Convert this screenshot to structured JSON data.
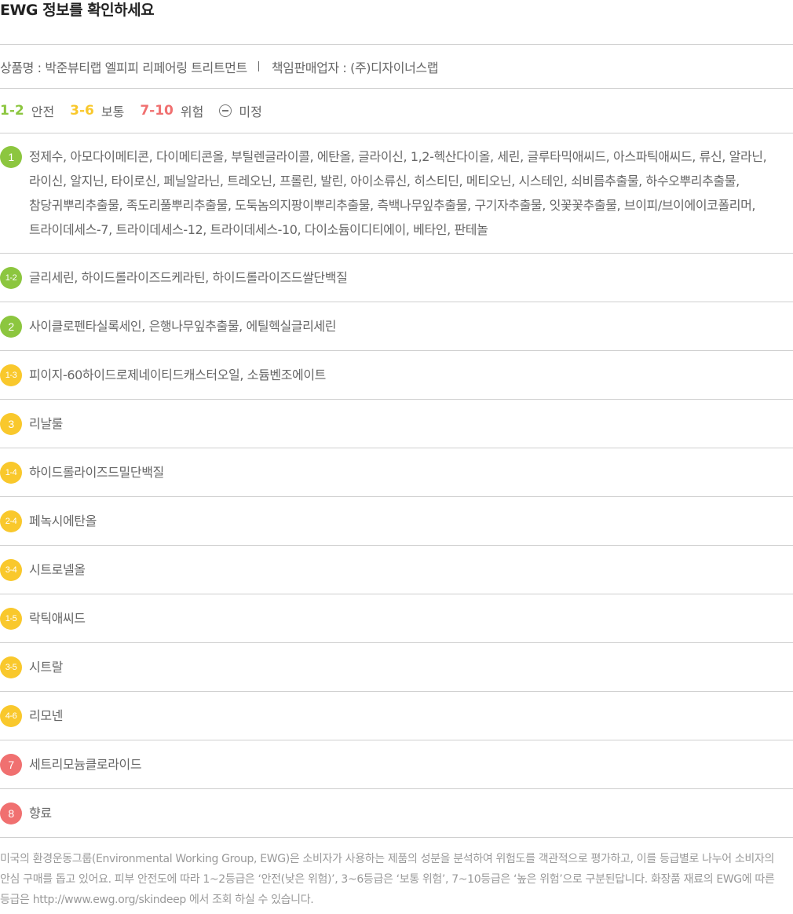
{
  "title": "EWG 정보를 확인하세요",
  "product": {
    "name_text": "상품명 : 박준뷰티랩 엘피피 리페어링 트리트먼트",
    "seller_text": "책임판매업자 : (주)디자이너스랩"
  },
  "legend": {
    "items": [
      {
        "range": "1-2",
        "label": "안전",
        "color": "#8cc63f"
      },
      {
        "range": "3-6",
        "label": "보통",
        "color": "#f9c82c"
      },
      {
        "range": "7-10",
        "label": "위험",
        "color": "#f07070"
      }
    ],
    "undefined_label": "미정",
    "undefined_icon": "minus-circle-icon"
  },
  "colors": {
    "green": "#8cc63f",
    "yellow": "#f9c82c",
    "red": "#f07070"
  },
  "rows": [
    {
      "grade": "1",
      "color": "#8cc63f",
      "ingredients": "정제수, 아모다이메티콘, 다이메티콘올, 부틸렌글라이콜, 에탄올, 글라이신, 1,2-헥산다이올, 세린, 글루타믹애씨드, 아스파틱애씨드, 류신, 알라닌, 라이신, 알지닌, 타이로신, 페닐알라닌, 트레오닌, 프롤린, 발린, 아이소류신, 히스티딘, 메티오닌, 시스테인, 쇠비름추출물, 하수오뿌리추출물, 참당귀뿌리추출물, 족도리풀뿌리추출물, 도둑놈의지팡이뿌리추출물, 측백나무잎추출물, 구기자추출물, 잇꽃꽃추출물, 브이피/브이에이코폴리머, 트라이데세스-7, 트라이데세스-12, 트라이데세스-10, 다이소듐이디티에이, 베타인, 판테놀"
    },
    {
      "grade": "1-2",
      "color": "#8cc63f",
      "ingredients": "글리세린, 하이드롤라이즈드케라틴, 하이드롤라이즈드쌀단백질"
    },
    {
      "grade": "2",
      "color": "#8cc63f",
      "ingredients": "사이클로펜타실록세인, 은행나무잎추출물, 에틸헥실글리세린"
    },
    {
      "grade": "1-3",
      "color": "#f9c82c",
      "ingredients": "피이지-60하이드로제네이티드캐스터오일, 소듐벤조에이트"
    },
    {
      "grade": "3",
      "color": "#f9c82c",
      "ingredients": "리날룰"
    },
    {
      "grade": "1-4",
      "color": "#f9c82c",
      "ingredients": "하이드롤라이즈드밀단백질"
    },
    {
      "grade": "2-4",
      "color": "#f9c82c",
      "ingredients": "페녹시에탄올"
    },
    {
      "grade": "3-4",
      "color": "#f9c82c",
      "ingredients": "시트로넬올"
    },
    {
      "grade": "1-5",
      "color": "#f9c82c",
      "ingredients": "락틱애씨드"
    },
    {
      "grade": "3-5",
      "color": "#f9c82c",
      "ingredients": "시트랄"
    },
    {
      "grade": "4-6",
      "color": "#f9c82c",
      "ingredients": "리모넨"
    },
    {
      "grade": "7",
      "color": "#f07070",
      "ingredients": "세트리모늄클로라이드"
    },
    {
      "grade": "8",
      "color": "#f07070",
      "ingredients": "향료"
    }
  ],
  "footnote": "미국의 환경운동그룹(Environmental Working Group, EWG)은 소비자가 사용하는 제품의 성분을 분석하여 위험도를 객관적으로 평가하고, 이를 등급별로 나누어 소비자의 안심 구매를 돕고 있어요. 피부 안전도에 따라 1~2등급은 ‘안전(낮은 위험)’, 3~6등급은 ‘보통 위험’, 7~10등급은 ‘높은 위험’으로 구분된답니다. 화장품 재료의 EWG에 따른 등급은 http://www.ewg.org/skindeep 에서 조회 하실 수 있습니다."
}
